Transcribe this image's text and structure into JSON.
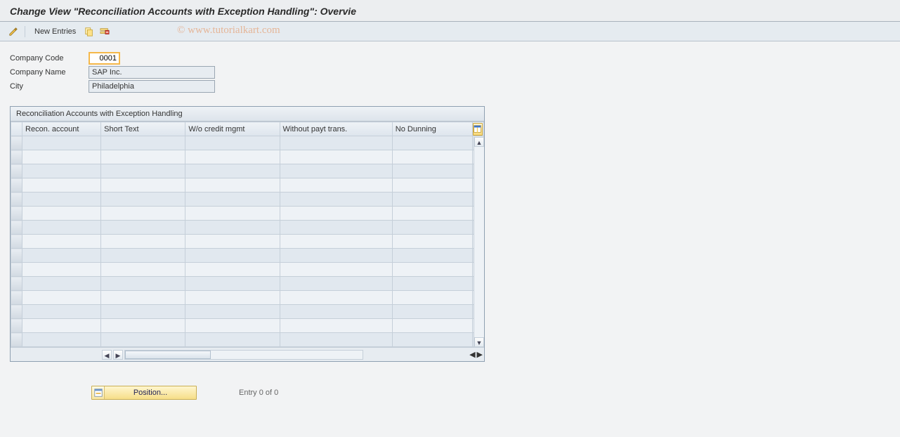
{
  "title": "Change View \"Reconciliation Accounts with Exception Handling\": Overvie",
  "toolbar": {
    "new_entries_label": "New Entries"
  },
  "watermark": "© www.tutorialkart.com",
  "form": {
    "company_code_label": "Company Code",
    "company_code_value": "0001",
    "company_name_label": "Company Name",
    "company_name_value": "SAP Inc.",
    "city_label": "City",
    "city_value": "Philadelphia"
  },
  "grid": {
    "title": "Reconciliation Accounts with Exception Handling",
    "columns": {
      "recon": "Recon. account",
      "short": "Short Text",
      "wocm": "W/o credit mgmt",
      "wopt": "Without payt trans.",
      "nodun": "No Dunning"
    },
    "row_count": 15
  },
  "footer": {
    "position_label": "Position...",
    "entry_text": "Entry 0 of 0"
  }
}
